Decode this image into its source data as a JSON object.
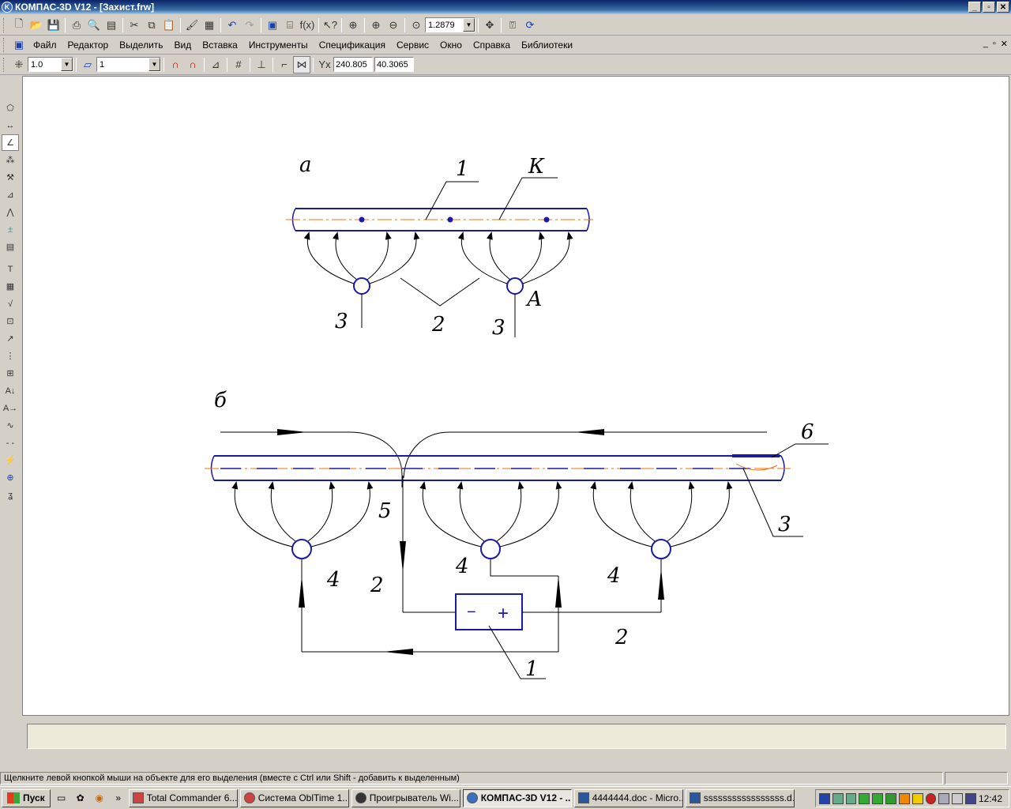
{
  "window": {
    "title": "КОМПАС-3D V12 - [Захист.frw]"
  },
  "toolbar1": {
    "zoom_value": "1.2879"
  },
  "menu": {
    "items": [
      "Файл",
      "Редактор",
      "Выделить",
      "Вид",
      "Вставка",
      "Инструменты",
      "Спецификация",
      "Сервис",
      "Окно",
      "Справка",
      "Библиотеки"
    ]
  },
  "toolbar3": {
    "step_value": "1.0",
    "layer_value": "1",
    "coord_x": "240.805",
    "coord_y": "40.3065"
  },
  "drawing": {
    "label_a": "а",
    "label_b": "б",
    "a_labels": {
      "n1": "1",
      "nK": "К",
      "n3_left": "3",
      "n2": "2",
      "n3_right": "3",
      "nA": "А"
    },
    "b_labels": {
      "n6": "6",
      "n5": "5",
      "n3": "3",
      "n4_left": "4",
      "n4_mid": "4",
      "n4_right": "4",
      "n2_left": "2",
      "n2_right": "2",
      "n1": "1",
      "minus": "−",
      "plus": "+"
    }
  },
  "status": {
    "message": "Щелкните левой кнопкой мыши на объекте для его выделения (вместе с Ctrl или Shift - добавить к выделенным)"
  },
  "taskbar": {
    "start_label": "Пуск",
    "tasks": [
      "Total Commander 6....",
      "Система OblTime 1....",
      "Проигрыватель Wi...",
      "КОМПАС-3D V12 - ...",
      "4444444.doc - Micro...",
      "sssssssssssssssss.d..."
    ],
    "clock": "12:42"
  }
}
